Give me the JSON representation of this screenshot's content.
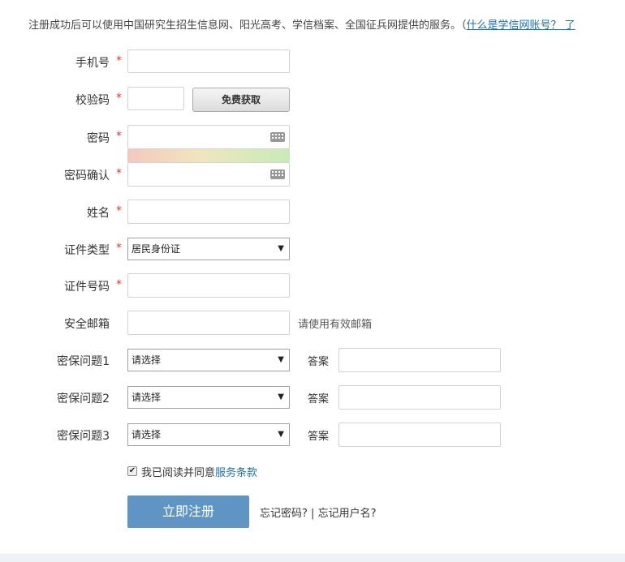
{
  "intro": {
    "text": "注册成功后可以使用中国研究生招生信息网、阳光高考、学信档案、全国征兵网提供的服务。（",
    "link": "什么是学信网账号？",
    "tail": " 了"
  },
  "form": {
    "phone_label": "手机号",
    "code_label": "校验码",
    "code_button": "免费获取",
    "password_label": "密码",
    "password_confirm_label": "密码确认",
    "name_label": "姓名",
    "id_type_label": "证件类型",
    "id_type_value": "居民身份证",
    "id_number_label": "证件号码",
    "email_label": "安全邮箱",
    "email_hint": "请使用有效邮箱",
    "required_mark": "*",
    "q1_label": "密保问题1",
    "q2_label": "密保问题2",
    "q3_label": "密保问题3",
    "question_placeholder": "请选择",
    "answer_label": "答案",
    "select_arrow": "▼"
  },
  "agreement": {
    "checked_mark": "✔",
    "text": "我已阅读并同意",
    "link": "服务条款"
  },
  "submit_label": "立即注册",
  "forgot": {
    "password": "忘记密码?",
    "separator": " | ",
    "username": "忘记用户名?"
  }
}
